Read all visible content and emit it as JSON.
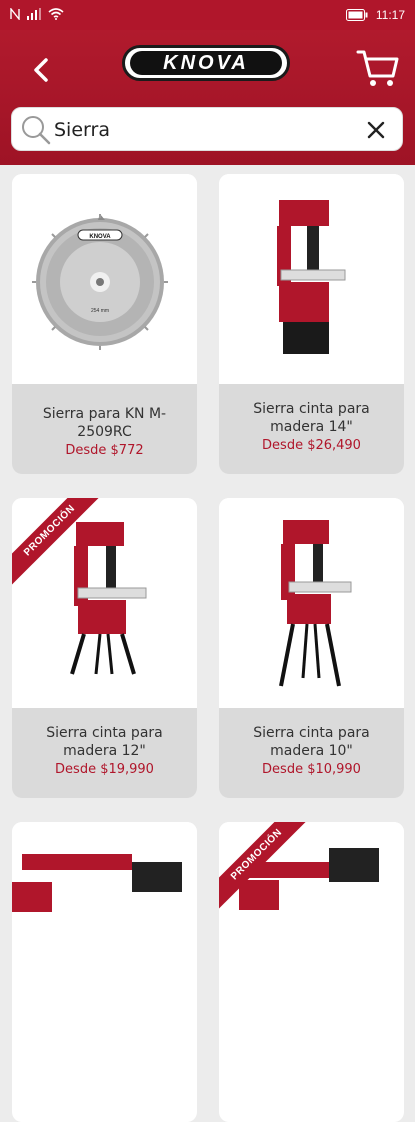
{
  "status": {
    "time": "11:17"
  },
  "header": {
    "logo_text": "KNOVA"
  },
  "search": {
    "value": "Sierra",
    "placeholder": ""
  },
  "products": [
    {
      "name": "Sierra para KN M-2509RC",
      "price": "Desde $772",
      "promo": ""
    },
    {
      "name": "Sierra cinta para madera 14\"",
      "price": "Desde $26,490",
      "promo": ""
    },
    {
      "name": "Sierra cinta para madera 12\"",
      "price": "Desde $19,990",
      "promo": "PROMOCIÓN"
    },
    {
      "name": "Sierra cinta para madera 10\"",
      "price": "Desde $10,990",
      "promo": ""
    },
    {
      "name": "",
      "price": "",
      "promo": ""
    },
    {
      "name": "",
      "price": "",
      "promo": "PROMOCIÓN"
    }
  ],
  "colors": {
    "brand_red": "#b0162b",
    "price_red": "#b0162b",
    "caption_bg": "#dadada"
  }
}
